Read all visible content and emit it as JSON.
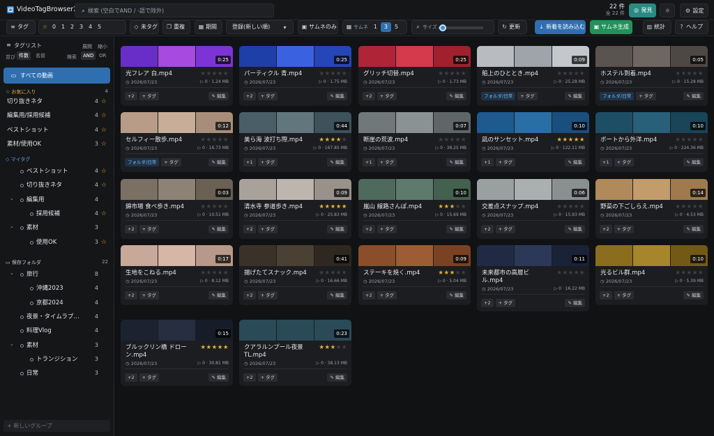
{
  "app": {
    "title": "VideoTagBrowser2"
  },
  "search": {
    "placeholder": "検索 (空白でAND / -語で除外)"
  },
  "count": {
    "shown": "22 件",
    "total": "全 22 件"
  },
  "topbar": {
    "discover": "発見",
    "settings": "設定"
  },
  "toolbar": {
    "tag": "タグ",
    "rating_values": [
      "0",
      "1",
      "2",
      "3",
      "4",
      "5"
    ],
    "untagged": "未タグ",
    "duplicates": "重複",
    "period": "期間",
    "sort": "登録(新しい順)",
    "thumb_only": "サムネのみ",
    "thumbs_label": "サムネ",
    "thumb_counts": [
      "1",
      "3",
      "5"
    ],
    "thumb_selected": "3",
    "size_label": "サイズ",
    "size_level": 0.1,
    "refresh": "更新",
    "import": "新着を読み込む",
    "generate": "サムネ生成",
    "stats": "統計",
    "help": "ヘルプ"
  },
  "sidebar": {
    "tag_list": "タグリスト",
    "expand": "展開",
    "collapse": "縮小",
    "sort_label": "並び",
    "sort_order": "件数",
    "sort_name": "名前",
    "match_label": "検索",
    "and": "AND",
    "or": "OR",
    "all_videos": "すべての動画",
    "favorites": {
      "title": "お気に入り",
      "count": "4",
      "items": [
        {
          "label": "切り抜きネタ",
          "count": "4"
        },
        {
          "label": "編集用/採用候補",
          "count": "4"
        },
        {
          "label": "ベストショット",
          "count": "4"
        },
        {
          "label": "素材/使用OK",
          "count": "3"
        }
      ]
    },
    "mytags": {
      "title": "マイタグ",
      "items": [
        {
          "label": "ベストショット",
          "count": "4",
          "star": true,
          "level": 1
        },
        {
          "label": "切り抜きネタ",
          "count": "4",
          "star": true,
          "level": 1
        },
        {
          "label": "編集用",
          "count": "4",
          "star": false,
          "level": 1,
          "expanded": true
        },
        {
          "label": "採用候補",
          "count": "4",
          "star": true,
          "level": 2
        },
        {
          "label": "素材",
          "count": "3",
          "star": false,
          "level": 1,
          "expanded": true
        },
        {
          "label": "使用OK",
          "count": "3",
          "star": true,
          "level": 2
        }
      ]
    },
    "folders": {
      "title": "保存フォルダ",
      "count": "22",
      "items": [
        {
          "label": "旅行",
          "count": "8",
          "level": 1,
          "expanded": true
        },
        {
          "label": "沖縄2023",
          "count": "4",
          "level": 2
        },
        {
          "label": "京都2024",
          "count": "4",
          "level": 2
        },
        {
          "label": "夜景・タイムラプ…",
          "count": "4",
          "level": 1
        },
        {
          "label": "料理Vlog",
          "count": "4",
          "level": 1
        },
        {
          "label": "素材",
          "count": "3",
          "level": 1,
          "expanded": true
        },
        {
          "label": "トランジション",
          "count": "3",
          "level": 2
        },
        {
          "label": "日常",
          "count": "3",
          "level": 1
        }
      ]
    },
    "new_group_placeholder": "+ 新しいグループ"
  },
  "card_labels": {
    "add_tag": "+ タグ",
    "edit": "編集"
  },
  "videos": [
    {
      "title": "光フレア 白.mp4",
      "date": "2026/07/23",
      "meta": "0 · 1.24 MB",
      "rating": 0,
      "duration": "0:25",
      "chips": [
        "+2"
      ],
      "frames": [
        "#6a2ec8",
        "#a64ae0",
        "#7d34d6"
      ]
    },
    {
      "title": "パーティクル 青.mp4",
      "date": "2026/07/23",
      "meta": "0 · 1.75 MB",
      "rating": 0,
      "duration": "0:25",
      "chips": [
        "+2"
      ],
      "frames": [
        "#1e3fa8",
        "#3a62e0",
        "#2446b8"
      ]
    },
    {
      "title": "グリッチ切替.mp4",
      "date": "2026/07/23",
      "meta": "0 · 1.73 MB",
      "rating": 0,
      "duration": "0:25",
      "chips": [
        "+2"
      ],
      "frames": [
        "#b02438",
        "#d43a4c",
        "#a0202e"
      ]
    },
    {
      "title": "船上のひととき.mp4",
      "date": "2026/07/23",
      "meta": "0 · 25.28 MB",
      "rating": 0,
      "duration": "0:09",
      "chips": [
        "フォルダ/日常"
      ],
      "frames": [
        "#b8bcc0",
        "#9ea4aa",
        "#c4c8cc"
      ]
    },
    {
      "title": "ホステル到着.mp4",
      "date": "2026/07/23",
      "meta": "0 · 15.28 MB",
      "rating": 0,
      "duration": "0:05",
      "chips": [
        "フォルダ/日常"
      ],
      "frames": [
        "#5a5450",
        "#6e6660",
        "#4e4844"
      ]
    },
    {
      "title": "セルフィー散歩.mp4",
      "date": "2026/07/23",
      "meta": "0 · 16.73 MB",
      "rating": 0,
      "duration": "0:12",
      "chips": [
        "フォルダ/日常"
      ],
      "frames": [
        "#b89c88",
        "#c8ae98",
        "#a88e7a"
      ]
    },
    {
      "title": "美ら海 波打ち際.mp4",
      "date": "2026/07/23",
      "meta": "0 · 167.85 MB",
      "rating": 4,
      "duration": "0:44",
      "chips": [
        "+1"
      ],
      "frames": [
        "#4a5e68",
        "#62767e",
        "#3e525c"
      ]
    },
    {
      "title": "断崖の荒波.mp4",
      "date": "2026/07/23",
      "meta": "0 · 38.25 MB",
      "rating": 0,
      "duration": "0:07",
      "chips": [
        "+1"
      ],
      "frames": [
        "#70787a",
        "#8a9294",
        "#5e6668"
      ]
    },
    {
      "title": "凪のサンセット.mp4",
      "date": "2026/07/23",
      "meta": "0 · 122.11 MB",
      "rating": 5,
      "duration": "0:10",
      "chips": [
        "+1"
      ],
      "frames": [
        "#1e5a8e",
        "#2a6ea6",
        "#1a4e7c"
      ]
    },
    {
      "title": "ボートから外洋.mp4",
      "date": "2026/07/23",
      "meta": "0 · 224.36 MB",
      "rating": 0,
      "duration": "0:10",
      "chips": [
        "+1"
      ],
      "frames": [
        "#1e4e66",
        "#28607a",
        "#1a4458"
      ]
    },
    {
      "title": "錦市場 食べ歩き.mp4",
      "date": "2026/07/23",
      "meta": "0 · 10.51 MB",
      "rating": 0,
      "duration": "0:03",
      "chips": [
        "+2"
      ],
      "frames": [
        "#7a7064",
        "#8c8276",
        "#6a6054"
      ]
    },
    {
      "title": "清水寺 参道歩き.mp4",
      "date": "2026/07/23",
      "meta": "0 · 25.83 MB",
      "rating": 5,
      "duration": "0:09",
      "chips": [
        "+2"
      ],
      "frames": [
        "#a8a29a",
        "#bcb6ae",
        "#98928a"
      ]
    },
    {
      "title": "嵐山 線路さんぽ.mp4",
      "date": "2026/07/23",
      "meta": "0 · 15.69 MB",
      "rating": 3,
      "duration": "0:10",
      "chips": [
        "+2"
      ],
      "frames": [
        "#4e6a5c",
        "#5e7a6c",
        "#44604e"
      ]
    },
    {
      "title": "交差点スナップ.mp4",
      "date": "2026/07/23",
      "meta": "0 · 15.93 MB",
      "rating": 0,
      "duration": "0:06",
      "chips": [
        "+2"
      ],
      "frames": [
        "#9aa0a0",
        "#aab0b0",
        "#8a9090"
      ]
    },
    {
      "title": "野菜の下ごしらえ.mp4",
      "date": "2026/07/23",
      "meta": "0 · 4.53 MB",
      "rating": 0,
      "duration": "0:14",
      "chips": [
        "+2"
      ],
      "frames": [
        "#b08a5a",
        "#c29c6a",
        "#9e7a4e"
      ]
    },
    {
      "title": "生地をこねる.mp4",
      "date": "2026/07/23",
      "meta": "0 · 8.12 MB",
      "rating": 0,
      "duration": "0:17",
      "chips": [
        "+2"
      ],
      "frames": [
        "#c8a898",
        "#d6b6a6",
        "#b89888"
      ]
    },
    {
      "title": "揚げたてスナック.mp4",
      "date": "2026/07/23",
      "meta": "0 · 16.66 MB",
      "rating": 0,
      "duration": "0:41",
      "chips": [
        "+2"
      ],
      "frames": [
        "#3a3228",
        "#4a4034",
        "#2e2820"
      ]
    },
    {
      "title": "ステーキを焼く.mp4",
      "date": "2026/07/23",
      "meta": "0 · 5.04 MB",
      "rating": 3,
      "duration": "0:09",
      "chips": [
        "+2"
      ],
      "frames": [
        "#8a4e2a",
        "#9c5c34",
        "#7a4222"
      ]
    },
    {
      "title": "未来都市の高層ビル.mp4",
      "date": "2026/07/23",
      "meta": "0 · 16.22 MB",
      "rating": 0,
      "duration": "0:11",
      "chips": [
        "+2"
      ],
      "frames": [
        "#202a44",
        "#2c3858",
        "#1a2238"
      ]
    },
    {
      "title": "光るビル群.mp4",
      "date": "2026/07/23",
      "meta": "0 · 5.39 MB",
      "rating": 0,
      "duration": "0:10",
      "chips": [
        "+2"
      ],
      "frames": [
        "#8a6e1e",
        "#a6862a",
        "#725a16"
      ]
    },
    {
      "title": "ブルックリン橋 ドローン.mp4",
      "date": "2026/07/23",
      "meta": "0 · 30.81 MB",
      "rating": 5,
      "duration": "0:15",
      "chips": [
        "+2"
      ],
      "frames": [
        "#1c2230",
        "#262e40",
        "#161c28"
      ]
    },
    {
      "title": "クアラルンプール夜景TL.mp4",
      "date": "2026/07/23",
      "meta": "0 · 38.13 MB",
      "rating": 3,
      "duration": "0:23",
      "chips": [
        "+2"
      ],
      "frames": [
        "#2a4a58",
        "#2a4a58",
        "#2a4a58"
      ]
    }
  ],
  "colors": {
    "accent": "#2f6fb0",
    "teal": "#2a8a83",
    "star": "#e0b437",
    "green": "#23925a"
  }
}
